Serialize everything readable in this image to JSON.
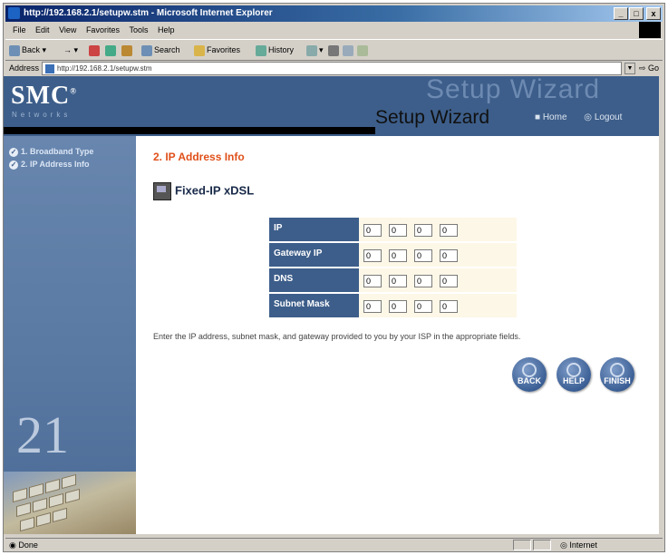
{
  "window": {
    "title": "http://192.168.2.1/setupw.stm - Microsoft Internet Explorer",
    "minimize": "_",
    "maximize": "□",
    "close": "x"
  },
  "menubar": [
    "File",
    "Edit",
    "View",
    "Favorites",
    "Tools",
    "Help"
  ],
  "toolbar": {
    "back": "Back",
    "search": "Search",
    "favorites": "Favorites",
    "history": "History"
  },
  "address": {
    "label": "Address",
    "url": "http://192.168.2.1/setupw.stm",
    "go": "Go"
  },
  "banner": {
    "logo": "SMC",
    "logo_mark": "®",
    "tagline": "Networks",
    "watermark": "Setup Wizard",
    "title": "Setup Wizard",
    "home_link": "Home",
    "logout_link": "Logout"
  },
  "sidebar": {
    "steps": [
      "1. Broadband Type",
      "2. IP Address Info"
    ],
    "decoration_text": "21"
  },
  "main": {
    "section_title": "2. IP Address Info",
    "connection_type": "Fixed-IP xDSL",
    "fields": [
      {
        "label": "IP",
        "octets": [
          "0",
          "0",
          "0",
          "0"
        ]
      },
      {
        "label": "Gateway IP",
        "octets": [
          "0",
          "0",
          "0",
          "0"
        ]
      },
      {
        "label": "DNS",
        "octets": [
          "0",
          "0",
          "0",
          "0"
        ]
      },
      {
        "label": "Subnet Mask",
        "octets": [
          "0",
          "0",
          "0",
          "0"
        ]
      }
    ],
    "instruction": "Enter the IP address, subnet mask, and gateway provided to you by your ISP in the appropriate fields.",
    "buttons": {
      "back": "BACK",
      "help": "HELP",
      "finish": "FINISH"
    }
  },
  "statusbar": {
    "left": "Done",
    "zone": "Internet"
  },
  "colors": {
    "banner": "#3d5e8a",
    "accent_title": "#e0501a",
    "table_label_bg": "#3d5e8a",
    "table_value_bg": "#fdf7e7"
  }
}
